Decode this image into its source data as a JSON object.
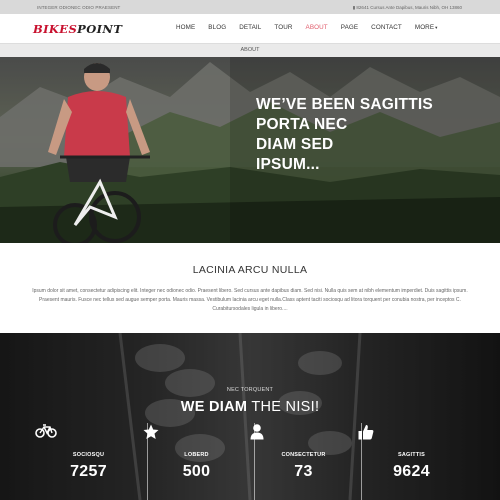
{
  "topbar": {
    "left_text": "INTEGER ODIONEC ODIO PRAESENT",
    "right_text": "▮ 82641 Cursus Ante Dapibus, Mauris Nibh, OH 13860"
  },
  "brand": {
    "part1": "BIKES",
    "part2": "POINT"
  },
  "nav": {
    "items": [
      "HOME",
      "BLOG",
      "DETAIL",
      "TOUR",
      "ABOUT",
      "PAGE",
      "CONTACT",
      "MORE"
    ],
    "active": "ABOUT",
    "more_caret": "▾"
  },
  "breadcrumb": "ABOUT",
  "hero": {
    "lines": [
      "WE’VE BEEN SAGITTIS",
      "PORTA NEC",
      "DIAM SED",
      "IPSUM..."
    ]
  },
  "section": {
    "title": "LACINIA ARCU NULLA",
    "body": "Ipsum dolor sit amet, consectetur adipiscing elit. Integer nec odionec odio. Praesent libero. Sed cursus ante dapibus diam. Sed nisi. Nulla quis sem at nibh elementum imperdiet. Duis sagittis ipsum. Praesent mauris. Fusce nec tellus sed augue semper porta. Mauris massa. Vestibulum lacinia arcu eget nulla.Class aptent taciti sociosqu ad litora torquent per conubia nostra, per inceptos C. Curabitursodales ligula in libero...."
  },
  "stats": {
    "subtitle": "NEC TORQUENT",
    "headline_bold": "WE DIAM",
    "headline_thin": " THE NISI!",
    "items": [
      {
        "icon": "bicycle-icon",
        "label": "SOCIOSQU",
        "value": "7257"
      },
      {
        "icon": "star-icon",
        "label": "LOBERD",
        "value": "500"
      },
      {
        "icon": "user-icon",
        "label": "CONSECTETUR",
        "value": "73"
      },
      {
        "icon": "thumbs-up-icon",
        "label": "SAGITTIS",
        "value": "9624"
      }
    ]
  },
  "colors": {
    "brand_red": "#c8102e",
    "active_nav": "#e05b6b"
  }
}
